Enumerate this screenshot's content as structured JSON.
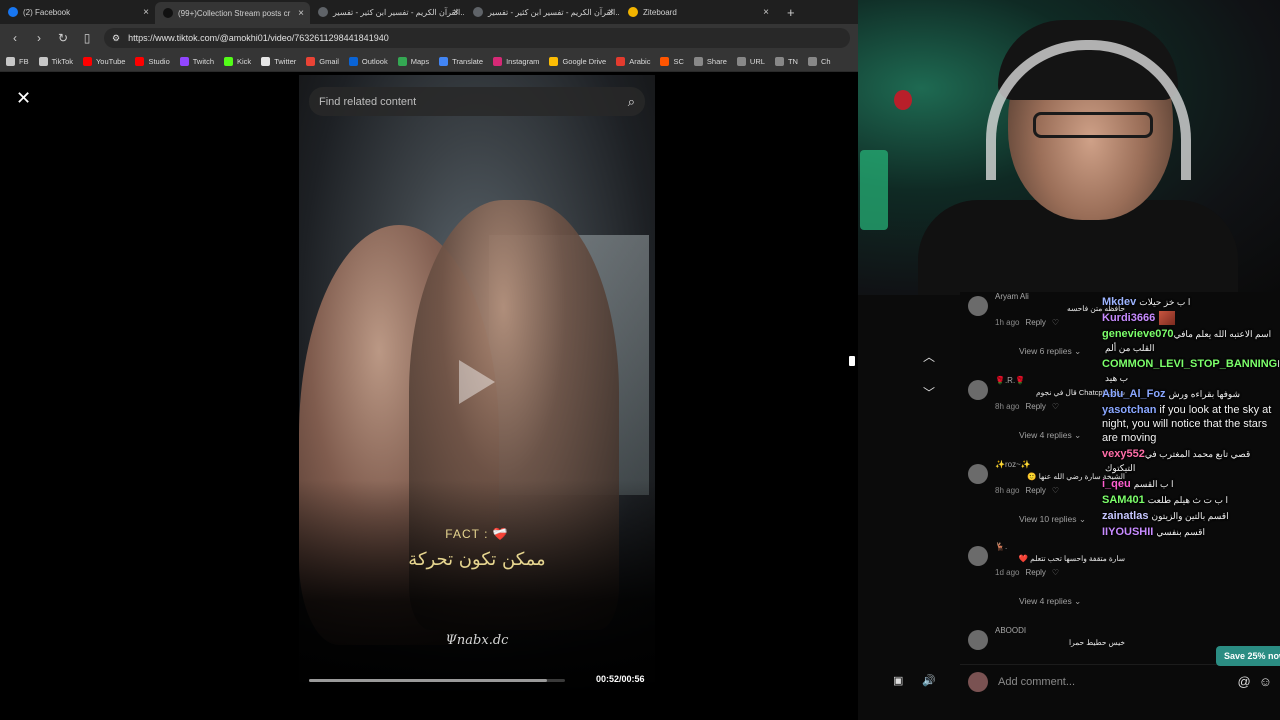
{
  "browser": {
    "tabs": [
      {
        "label": "(2) Facebook",
        "icon": "facebook-icon",
        "color": "#1877f2",
        "active": false
      },
      {
        "label": "(99+)Collection Stream posts cr",
        "icon": "tiktok-icon",
        "color": "#111111",
        "active": true
      },
      {
        "label": "القرآن الكريم - تفسير ابن كثير - تفسير...",
        "icon": "globe-icon",
        "color": "#5f6368",
        "active": false
      },
      {
        "label": "القرآن الكريم - تفسير ابن كثير - تفسير...",
        "icon": "globe-icon",
        "color": "#5f6368",
        "active": false
      },
      {
        "label": "Ziteboard",
        "icon": "ziteboard-icon",
        "color": "#f2b400",
        "active": false
      }
    ],
    "url": "https://www.tiktok.com/@amokhi01/video/7632611298441841940",
    "bookmarks": [
      {
        "label": "FB",
        "color": "#c7c7c7"
      },
      {
        "label": "TikTok",
        "color": "#c7c7c7"
      },
      {
        "label": "YouTube",
        "color": "#ff0000"
      },
      {
        "label": "Studio",
        "color": "#ff0000"
      },
      {
        "label": "Twitch",
        "color": "#9146ff"
      },
      {
        "label": "Kick",
        "color": "#53fc18"
      },
      {
        "label": "Twitter",
        "color": "#e7e7e7"
      },
      {
        "label": "Gmail",
        "color": "#ea4335"
      },
      {
        "label": "Outlook",
        "color": "#0a64d6"
      },
      {
        "label": "Maps",
        "color": "#34a853"
      },
      {
        "label": "Translate",
        "color": "#4285f4"
      },
      {
        "label": "Instagram",
        "color": "#d62976"
      },
      {
        "label": "Google Drive",
        "color": "#fbbc04"
      },
      {
        "label": "Arabic",
        "color": "#e33b2e"
      },
      {
        "label": "SC",
        "color": "#ff5500"
      },
      {
        "label": "Share",
        "color": "#888888"
      },
      {
        "label": "URL",
        "color": "#888888"
      },
      {
        "label": "TN",
        "color": "#888888"
      },
      {
        "label": "Ch",
        "color": "#888888"
      }
    ]
  },
  "tiktok": {
    "search_placeholder": "Find related content",
    "overlay_fact": "FACT : ❤️‍🩹",
    "overlay_caption": "ممكن تكون تحركة",
    "overlay_signature": "Ψnabx.dc",
    "time": "00:52/00:56",
    "progress_fraction": 0.93
  },
  "comments": [
    {
      "name": "Aryam Ali",
      "text": "حافظه متن فاحسه",
      "time": "1h ago",
      "reply": "Reply",
      "replies": "View 6 replies ⌄"
    },
    {
      "name": "🌹.R.🌹",
      "text": "سالت Chatcpt قال في نجوم",
      "time": "8h ago",
      "reply": "Reply",
      "replies": "View 4 replies ⌄"
    },
    {
      "name": "✨roz~✨",
      "text": "الشيخة سارة رضي الله عنها 🙂",
      "time": "8h ago",
      "reply": "Reply",
      "replies": "View 10 replies ⌄"
    },
    {
      "name": "🦌.",
      "text": "سارة متقفة واحسها تحب تتعلم ❤️",
      "time": "1d ago",
      "reply": "Reply",
      "replies": "View 4 replies ⌄"
    },
    {
      "name": "ABOODI",
      "text": "خيس حطيط حمرا",
      "time": "",
      "reply": "",
      "replies": ""
    }
  ],
  "add_comment_placeholder": "Add comment...",
  "chat": [
    {
      "user": "Mkdev",
      "color": "#9db4ff",
      "text": "ا ب خز حيلات",
      "rtl": true
    },
    {
      "user": "Kurdi3666",
      "color": "#c78bff",
      "text": "",
      "rtl": false,
      "badge": true
    },
    {
      "user": "genevieve070",
      "color": "#7cff6b",
      "text": "اسم الاعتبه الله يعلم مافي القلب من ألم",
      "rtl": true
    },
    {
      "user": "COMMON_LEVI_STOP_BANNING",
      "color": "#7cff6b",
      "text": "ا ب هيد",
      "rtl": true
    },
    {
      "user": "Abu_Al_Foz",
      "color": "#8aa7ff",
      "text": "شوفها بقراءه ورش",
      "rtl": true
    },
    {
      "user": "yasotchan",
      "color": "#8aa7ff",
      "text": "if you look at the sky at night, you will notice that the stars are moving",
      "rtl": false
    },
    {
      "user": "vexy552",
      "color": "#ff6ea8",
      "text": "قصي تابع محمد المغترب في التيكتوك",
      "rtl": true
    },
    {
      "user": "i_qeu",
      "color": "#ff5fd0",
      "text": "ا ب القسم",
      "rtl": true
    },
    {
      "user": "SAM401",
      "color": "#7cff6b",
      "text": "ا ب ت ث هيلم طلعت",
      "rtl": true
    },
    {
      "user": "zainatlas",
      "color": "#c6c6ff",
      "text": "اقسم بالتين والزيتون",
      "rtl": true
    },
    {
      "user": "IIYOUSHII",
      "color": "#c78bff",
      "text": "اقسم بنفسي",
      "rtl": true
    }
  ],
  "promo": "Save 25% now"
}
